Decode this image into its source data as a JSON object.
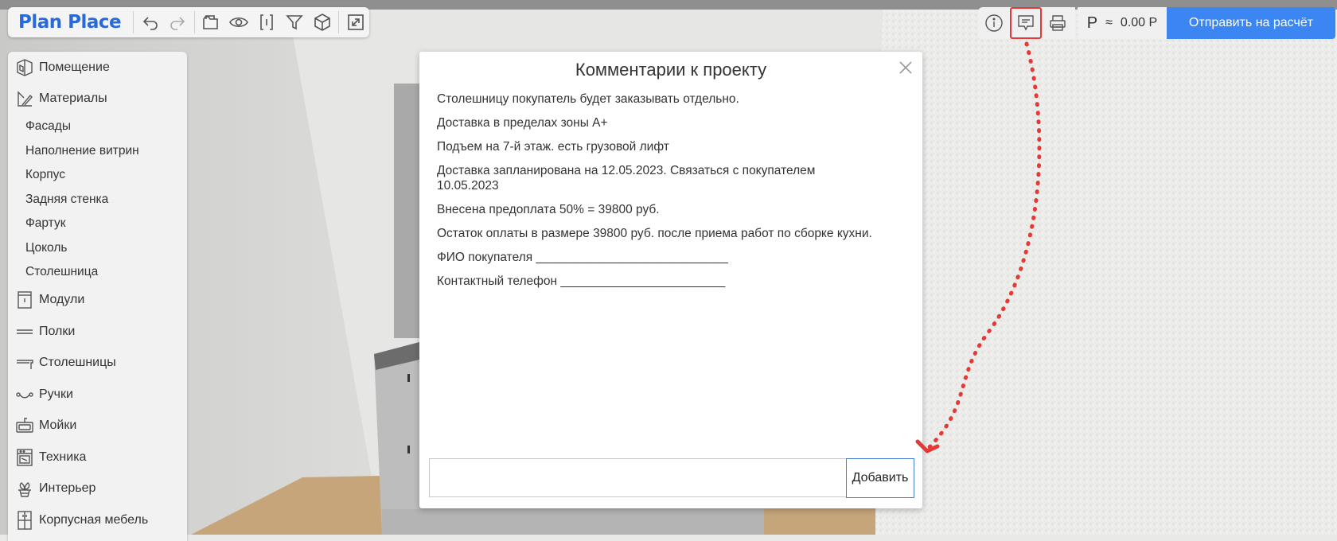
{
  "app": {
    "logo": "Plan Place"
  },
  "toolbar": {
    "buttons": [
      {
        "name": "undo-button",
        "icon": "undo-icon"
      },
      {
        "name": "redo-button",
        "icon": "redo-icon"
      },
      {
        "name": "open-project-button",
        "icon": "folder-icon"
      },
      {
        "name": "view-button",
        "icon": "eye-icon"
      },
      {
        "name": "dimensions-button",
        "icon": "frame-brackets-icon"
      },
      {
        "name": "filter-button",
        "icon": "funnel-icon"
      },
      {
        "name": "3d-view-button",
        "icon": "cube-icon"
      },
      {
        "name": "fullscreen-button",
        "icon": "expand-icon"
      }
    ]
  },
  "topright": {
    "buttons": [
      {
        "name": "info-button",
        "icon": "info-icon"
      },
      {
        "name": "comments-button",
        "icon": "comment-icon",
        "active": true
      },
      {
        "name": "print-button",
        "icon": "printer-icon"
      }
    ],
    "currency_symbol": "Р",
    "approx": "≈",
    "price": "0.00 Р",
    "send_label": "Отправить на расчёт"
  },
  "sidebar": {
    "items": [
      {
        "label": "Помещение",
        "icon": "room-icon"
      },
      {
        "label": "Материалы",
        "icon": "materials-icon"
      },
      {
        "label": "Модули",
        "icon": "module-icon"
      },
      {
        "label": "Полки",
        "icon": "shelf-icon"
      },
      {
        "label": "Столешницы",
        "icon": "countertop-icon"
      },
      {
        "label": "Ручки",
        "icon": "handle-icon"
      },
      {
        "label": "Мойки",
        "icon": "sink-icon"
      },
      {
        "label": "Техника",
        "icon": "oven-icon"
      },
      {
        "label": "Интерьер",
        "icon": "plant-icon"
      },
      {
        "label": "Корпусная мебель",
        "icon": "cabinet-icon"
      }
    ],
    "material_subitems": [
      "Фасады",
      "Наполнение витрин",
      "Корпус",
      "Задняя стенка",
      "Фартук",
      "Цоколь",
      "Столешница"
    ]
  },
  "modal": {
    "title": "Комментарии к проекту",
    "comments": [
      "Столешницу покупатель будет заказывать отдельно.",
      "Доставка в пределах зоны А+",
      "Подъем на 7-й этаж. есть грузовой лифт",
      "Доставка запланирована на 12.05.2023. Связаться с покупателем 10.05.2023",
      "Внесена предоплата 50% = 39800 руб.",
      "Остаток оплаты в размере 39800 руб. после приема работ по сборке кухни.",
      "ФИО покупателя ____________________________",
      "Контактный телефон ________________________"
    ],
    "input_value": "",
    "add_label": "Добавить"
  },
  "colors": {
    "brand": "#2a6ad8",
    "send_button": "#3b86f2",
    "annotation_red": "#e53935"
  }
}
